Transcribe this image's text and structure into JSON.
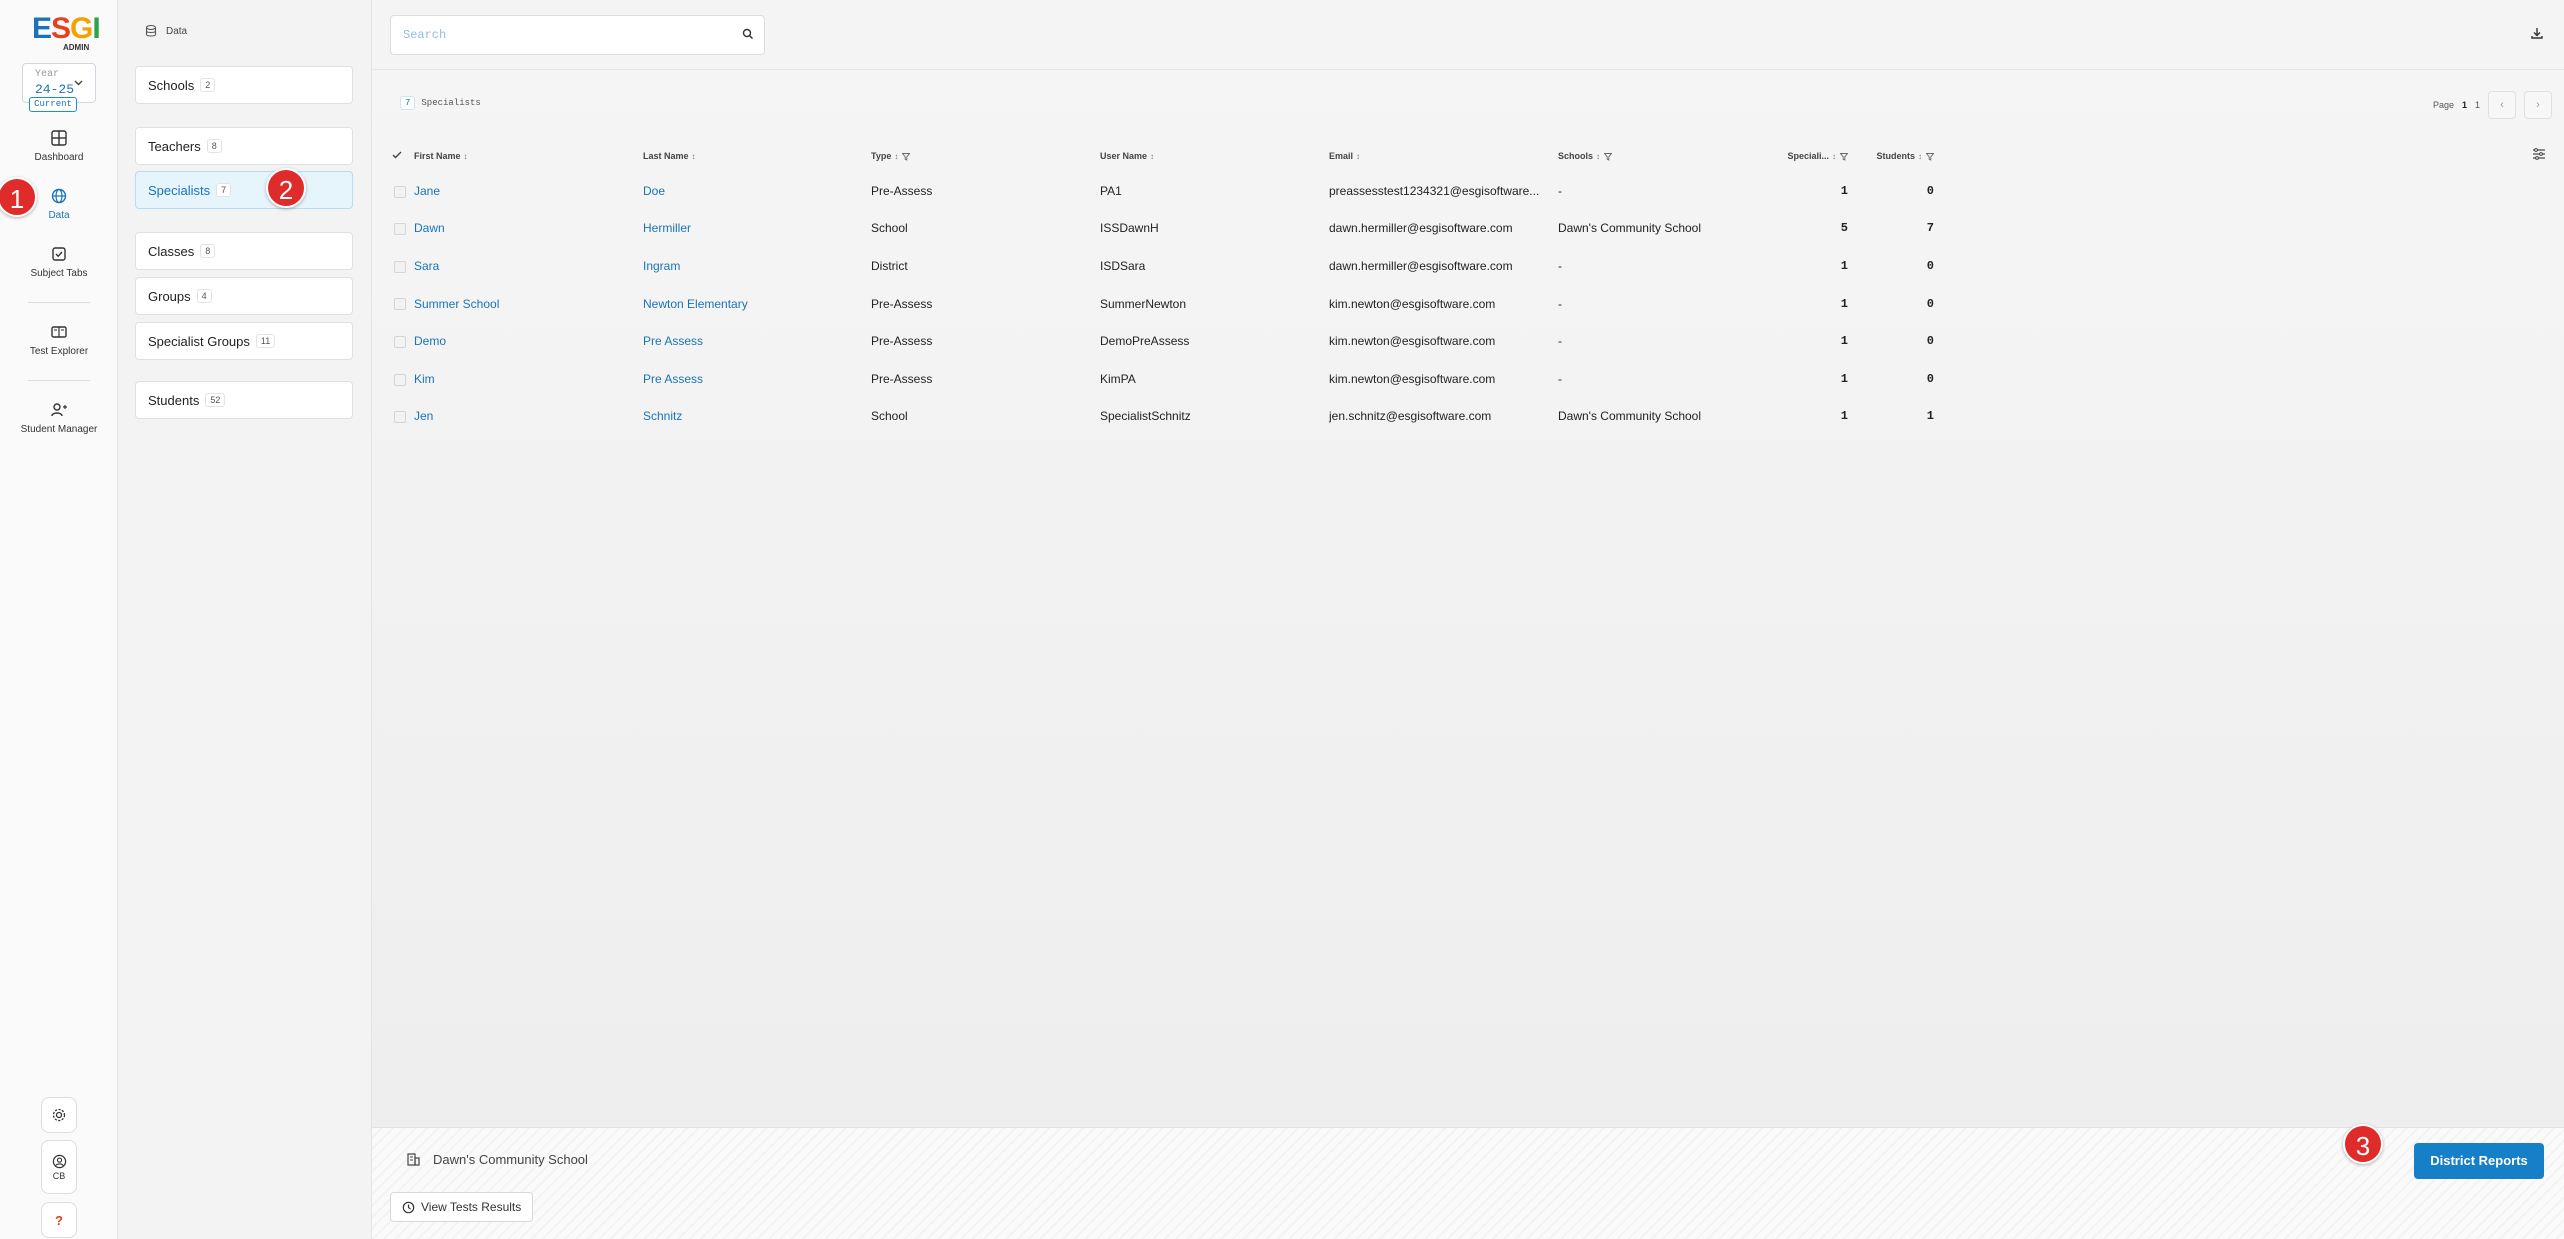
{
  "app": {
    "logo_text": "ESGI",
    "logo_sub": "ADMIN"
  },
  "year_selector": {
    "label": "Year",
    "value": "24-25",
    "badge": "Current"
  },
  "nav": {
    "items": [
      {
        "label": "Dashboard",
        "icon": "dashboard-icon"
      },
      {
        "label": "Data",
        "icon": "data-icon",
        "active": true
      },
      {
        "label": "Subject Tabs",
        "icon": "subject-tabs-icon"
      },
      {
        "label": "Test Explorer",
        "icon": "test-explorer-icon"
      },
      {
        "label": "Student Manager",
        "icon": "student-manager-icon"
      }
    ],
    "bottom": {
      "settings_icon": "gear-icon",
      "user_initials": "CB",
      "help": "?"
    }
  },
  "markers": {
    "m1": "1",
    "m2": "2",
    "m3": "3"
  },
  "data_panel": {
    "title": "Data",
    "categories": [
      {
        "label": "Schools",
        "count": "2"
      },
      {
        "label": "Teachers",
        "count": "8"
      },
      {
        "label": "Specialists",
        "count": "7",
        "active": true
      },
      {
        "label": "Classes",
        "count": "8"
      },
      {
        "label": "Groups",
        "count": "4"
      },
      {
        "label": "Specialist Groups",
        "count": "11"
      },
      {
        "label": "Students",
        "count": "52"
      }
    ]
  },
  "search": {
    "placeholder": "Search"
  },
  "summary": {
    "count": "7",
    "label": "Specialists"
  },
  "pager": {
    "label": "Page",
    "current": "1",
    "total": "1"
  },
  "table": {
    "columns": [
      "First Name",
      "Last Name",
      "Type",
      "User Name",
      "Email",
      "Schools",
      "Speciali...",
      "Students"
    ],
    "rows": [
      {
        "first": "Jane",
        "last": "Doe",
        "type": "Pre-Assess",
        "user": "PA1",
        "email": "preassesstest1234321@esgisoftware...",
        "schools": "-",
        "spec": "1",
        "students": "0"
      },
      {
        "first": "Dawn",
        "last": "Hermiller",
        "type": "School",
        "user": "ISSDawnH",
        "email": "dawn.hermiller@esgisoftware.com",
        "schools": "Dawn's Community School",
        "spec": "5",
        "students": "7"
      },
      {
        "first": "Sara",
        "last": "Ingram",
        "type": "District",
        "user": "ISDSara",
        "email": "dawn.hermiller@esgisoftware.com",
        "schools": "-",
        "spec": "1",
        "students": "0"
      },
      {
        "first": "Summer School",
        "last": "Newton Elementary",
        "type": "Pre-Assess",
        "user": "SummerNewton",
        "email": "kim.newton@esgisoftware.com",
        "schools": "-",
        "spec": "1",
        "students": "0"
      },
      {
        "first": "Demo",
        "last": "Pre Assess",
        "type": "Pre-Assess",
        "user": "DemoPreAssess",
        "email": "kim.newton@esgisoftware.com",
        "schools": "-",
        "spec": "1",
        "students": "0"
      },
      {
        "first": "Kim",
        "last": "Pre Assess",
        "type": "Pre-Assess",
        "user": "KimPA",
        "email": "kim.newton@esgisoftware.com",
        "schools": "-",
        "spec": "1",
        "students": "0"
      },
      {
        "first": "Jen",
        "last": "Schnitz",
        "type": "School",
        "user": "SpecialistSchnitz",
        "email": "jen.schnitz@esgisoftware.com",
        "schools": "Dawn's Community School",
        "spec": "1",
        "students": "1"
      }
    ]
  },
  "footer": {
    "school_name": "Dawn's Community School",
    "view_tests_label": "View Tests Results",
    "district_reports_label": "District Reports"
  },
  "colors": {
    "accent": "#1a73b8",
    "primary_button": "#1580c8",
    "marker": "#e02b2b",
    "active_category_bg": "#e6f4fc"
  }
}
